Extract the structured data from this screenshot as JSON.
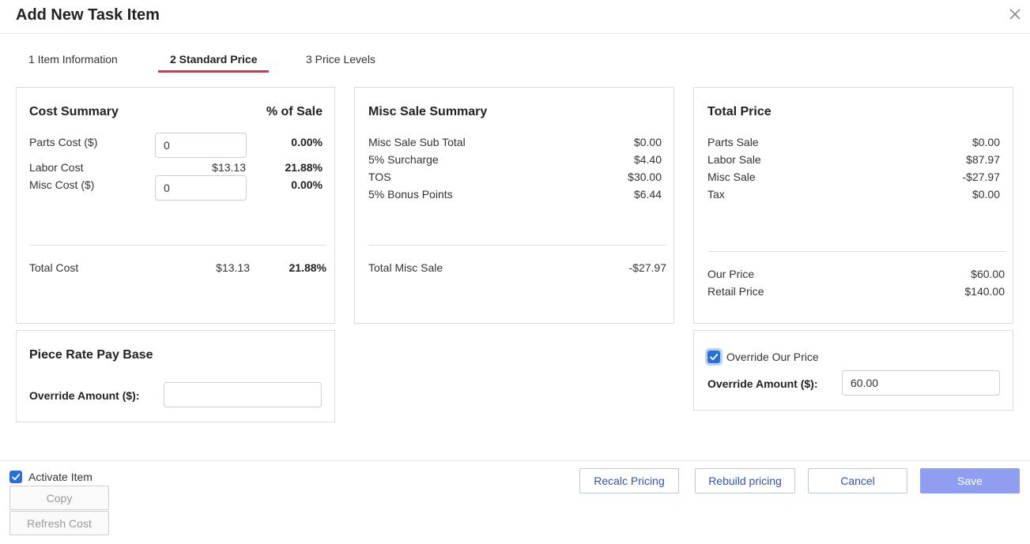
{
  "dialog": {
    "title": "Add New Task Item"
  },
  "tabs": [
    {
      "label": "1 Item Information"
    },
    {
      "label": "2 Standard Price"
    },
    {
      "label": "3 Price Levels"
    }
  ],
  "cost_summary": {
    "title": "Cost Summary",
    "pct_header": "% of Sale",
    "rows": [
      {
        "label": "Parts Cost ($)",
        "input_value": "0",
        "percent": "0.00%"
      },
      {
        "label": "Labor Cost",
        "value": "$13.13",
        "percent": "21.88%"
      },
      {
        "label": "Misc Cost ($)",
        "input_value": "0",
        "percent": "0.00%"
      }
    ],
    "total": {
      "label": "Total Cost",
      "value": "$13.13",
      "percent": "21.88%"
    }
  },
  "misc_sale_summary": {
    "title": "Misc Sale Summary",
    "rows": [
      {
        "label": "Misc Sale Sub Total",
        "value": "$0.00"
      },
      {
        "label": "5% Surcharge",
        "value": "$4.40"
      },
      {
        "label": "TOS",
        "value": "$30.00"
      },
      {
        "label": "5% Bonus Points",
        "value": "$6.44"
      }
    ],
    "total": {
      "label": "Total Misc Sale",
      "value": "-$27.97"
    }
  },
  "total_price": {
    "title": "Total Price",
    "rows": [
      {
        "label": "Parts Sale",
        "value": "$0.00"
      },
      {
        "label": "Labor Sale",
        "value": "$87.97"
      },
      {
        "label": "Misc Sale",
        "value": "-$27.97"
      },
      {
        "label": "Tax",
        "value": "$0.00"
      }
    ],
    "our_price": {
      "label": "Our Price",
      "value": "$60.00"
    },
    "retail_price": {
      "label": "Retail Price",
      "value": "$140.00"
    }
  },
  "piece_rate": {
    "title": "Piece Rate Pay Base",
    "override_label": "Override Amount ($):",
    "override_value": ""
  },
  "override_price": {
    "checkbox_label": "Override Our Price",
    "checked": true,
    "override_label": "Override Amount ($):",
    "override_value": "60.00"
  },
  "footer": {
    "activate_label": "Activate Item",
    "activate_checked": true,
    "copy_label": "Copy",
    "refresh_label": "Refresh Cost",
    "recalc_label": "Recalc Pricing",
    "rebuild_label": "Rebuild pricing",
    "cancel_label": "Cancel",
    "save_label": "Save"
  },
  "colors": {
    "tab_accent": "#e0314b",
    "checkbox": "#2a6fd6",
    "link_button_text": "#2b55b8",
    "save_button": "#8f9ef0"
  },
  "icons": {
    "close": "close-icon",
    "check": "checkmark-icon"
  }
}
